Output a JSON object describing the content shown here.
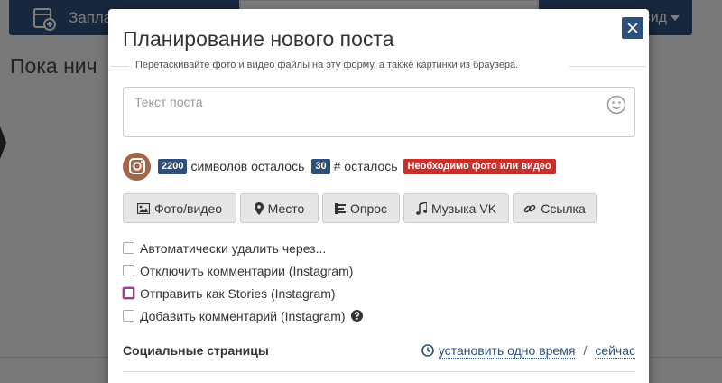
{
  "background": {
    "left_button_label": "Запла",
    "right_button_label": "вид",
    "page_heading": "Пока нич"
  },
  "modal": {
    "title": "Планирование нового поста",
    "hint": "Перетаскивайте фото и видео файлы на эту форму, а также картинки из браузера.",
    "textarea_placeholder": "Текст поста",
    "counters": {
      "chars_left_value": "2200",
      "chars_left_label": "символов осталось",
      "hashtags_left_value": "30",
      "hashtags_left_label": "# осталось",
      "warning": "Необходимо фото или видео"
    },
    "buttons": {
      "photo_video": "Фото/видео",
      "place": "Место",
      "poll": "Опрос",
      "music": "Музыка VK",
      "link": "Ссылка"
    },
    "options": {
      "auto_delete": "Автоматически удалить через...",
      "disable_comments": "Отключить комментарии (Instagram)",
      "send_as_stories": "Отправить как Stories (Instagram)",
      "add_comment": "Добавить комментарий (Instagram)"
    },
    "social": {
      "title": "Социальные страницы",
      "set_one_time": "установить одно время",
      "now": "сейчас"
    }
  },
  "colors": {
    "brand": "#2e4f7a",
    "warning": "#c9302c",
    "instagram_avatar": "#a0674a"
  }
}
